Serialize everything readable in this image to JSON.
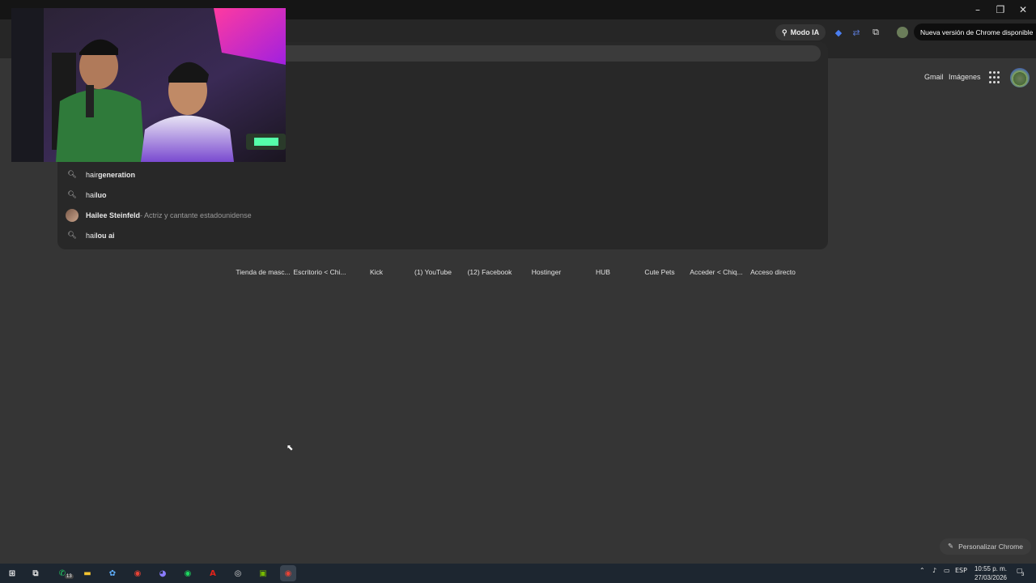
{
  "browser": {
    "modo_ia": "Modo IA",
    "update_chip": "Nueva versión de Chrome disponible"
  },
  "suggestions": [
    {
      "icon": "search-icon",
      "prefix": "hair",
      "rest": " generation",
      "sub": ""
    },
    {
      "icon": "search-icon",
      "prefix": "hai",
      "rest": "luo",
      "sub": ""
    },
    {
      "icon": "person-thumbnail",
      "prefix": "Hai",
      "rest": "lee Steinfeld",
      "sub": " - Actriz y cantante estadounidense"
    },
    {
      "icon": "search-icon",
      "prefix": "hai",
      "rest": "lou ai",
      "sub": ""
    }
  ],
  "google": {
    "gmail": "Gmail",
    "images": "Imágenes",
    "customize": "Personalizar Chrome"
  },
  "shortcuts": [
    {
      "label": "Tienda de masc...",
      "color": "#2f6f6f"
    },
    {
      "label": "Escritorio < Chi...",
      "color": "#2f6f6f"
    },
    {
      "label": "Kick",
      "color": "#53fc18"
    },
    {
      "label": "(1) YouTube",
      "color": "#d80f2a"
    },
    {
      "label": "(12) Facebook",
      "color": "#1877f2"
    },
    {
      "label": "Hostinger",
      "color": "#673de6"
    },
    {
      "label": "HUB",
      "color": "#7a3a7a"
    },
    {
      "label": "Cute Pets",
      "color": "#555555"
    },
    {
      "label": "Acceder < Chiq...",
      "color": "#2f6f6f"
    },
    {
      "label": "Acceso directo",
      "color": "#555555"
    }
  ],
  "taskbar": {
    "whatsapp_badge": "13",
    "language": "ESP",
    "time": "10:55 p. m.",
    "date": "27/03/2026",
    "notification_count": "3"
  }
}
